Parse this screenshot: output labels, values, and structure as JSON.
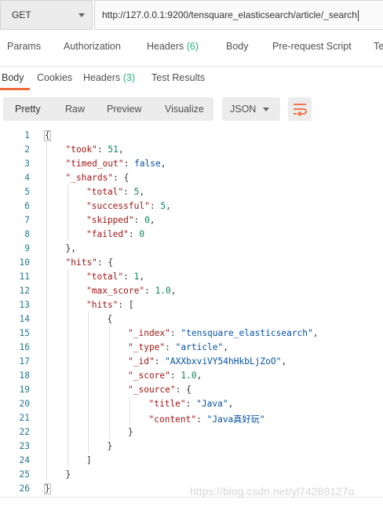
{
  "request": {
    "method": "GET",
    "url": "http://127.0.0.1:9200/tensquare_elasticsearch/article/_search"
  },
  "request_tabs": [
    {
      "label": "Params",
      "count": ""
    },
    {
      "label": "Authorization",
      "count": ""
    },
    {
      "label": "Headers",
      "count": "(6)"
    },
    {
      "label": "Body",
      "count": ""
    },
    {
      "label": "Pre-request Script",
      "count": ""
    },
    {
      "label": "Te",
      "count": ""
    }
  ],
  "response_tabs": [
    {
      "label": "Body",
      "count": ""
    },
    {
      "label": "Cookies",
      "count": ""
    },
    {
      "label": "Headers",
      "count": "(3)"
    },
    {
      "label": "Test Results",
      "count": ""
    }
  ],
  "view_modes": [
    "Pretty",
    "Raw",
    "Preview",
    "Visualize"
  ],
  "format": "JSON",
  "icons": {
    "method_caret": "chevron-down-icon",
    "format_caret": "chevron-down-icon",
    "wrap": "wrap-lines-icon"
  },
  "colors": {
    "accent": "#f26b3a",
    "count": "#26b47f",
    "line_number": "#237893"
  },
  "code_lines": [
    "{",
    "\"took\": 51,",
    "\"timed_out\": false,",
    "\"_shards\": {",
    "\"total\": 5,",
    "\"successful\": 5,",
    "\"skipped\": 0,",
    "\"failed\": 0",
    "},",
    "\"hits\": {",
    "\"total\": 1,",
    "\"max_score\": 1.0,",
    "\"hits\": [",
    "{",
    "\"_index\": \"tensquare_elasticsearch\",",
    "\"_type\": \"article\",",
    "\"_id\": \"AXXbxviVY54hHkbLjZoO\",",
    "\"_score\": 1.0,",
    "\"_source\": {",
    "\"title\": \"Java\",",
    "\"content\": \"Java真好玩\"",
    "}",
    "}",
    "]",
    "}",
    "}"
  ],
  "code_indents": [
    0,
    1,
    1,
    1,
    2,
    2,
    2,
    2,
    1,
    1,
    2,
    2,
    2,
    3,
    4,
    4,
    4,
    4,
    4,
    5,
    5,
    4,
    3,
    2,
    1,
    0
  ],
  "watermark": "https://blog.csdn.net/yl74289127o"
}
